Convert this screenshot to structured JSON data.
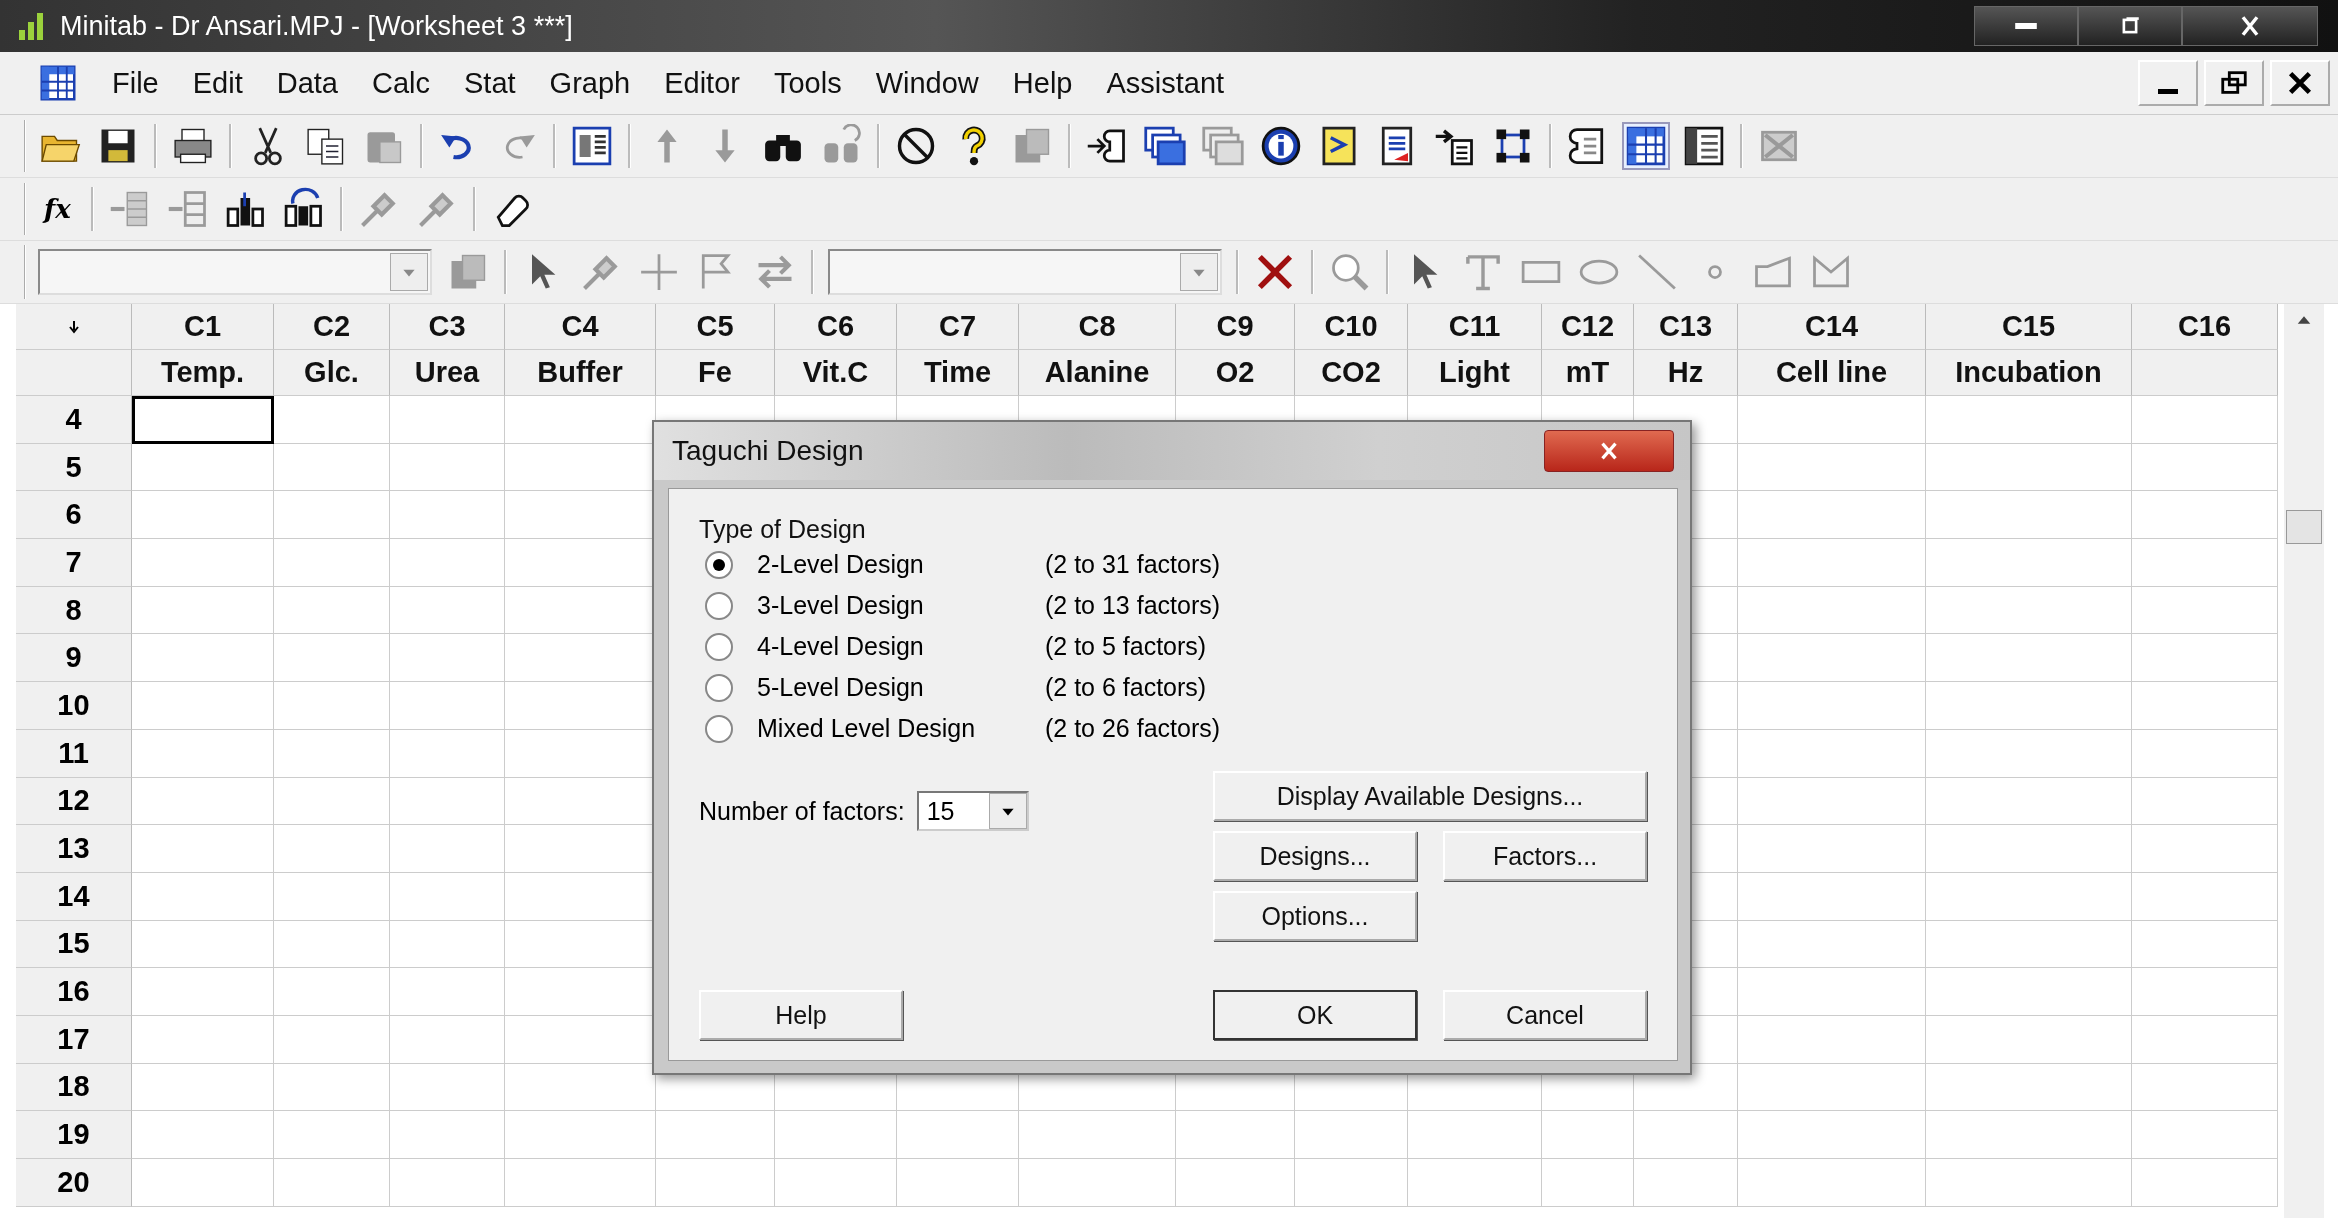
{
  "window": {
    "title": "Minitab - Dr Ansari.MPJ - [Worksheet 3 ***]"
  },
  "menu": [
    "File",
    "Edit",
    "Data",
    "Calc",
    "Stat",
    "Graph",
    "Editor",
    "Tools",
    "Window",
    "Help",
    "Assistant"
  ],
  "formula_toolbar": {
    "label": "fx"
  },
  "worksheet": {
    "columns": [
      {
        "id": "C1",
        "name": "Temp."
      },
      {
        "id": "C2",
        "name": "Glc."
      },
      {
        "id": "C3",
        "name": "Urea"
      },
      {
        "id": "C4",
        "name": "Buffer"
      },
      {
        "id": "C5",
        "name": "Fe"
      },
      {
        "id": "C6",
        "name": "Vit.C"
      },
      {
        "id": "C7",
        "name": "Time"
      },
      {
        "id": "C8",
        "name": "Alanine"
      },
      {
        "id": "C9",
        "name": "O2"
      },
      {
        "id": "C10",
        "name": "CO2"
      },
      {
        "id": "C11",
        "name": "Light"
      },
      {
        "id": "C12",
        "name": "mT"
      },
      {
        "id": "C13",
        "name": "Hz"
      },
      {
        "id": "C14",
        "name": "Cell line"
      },
      {
        "id": "C15",
        "name": "Incubation"
      },
      {
        "id": "C16"
      }
    ],
    "rows": [
      {
        "label": "4",
        "active": true
      },
      {
        "label": "5",
        "active": false
      },
      {
        "label": "6",
        "active": false
      },
      {
        "label": "7",
        "active": false
      },
      {
        "label": "8",
        "active": false
      },
      {
        "label": "9",
        "active": false
      },
      {
        "label": "10",
        "active": false
      },
      {
        "label": "11",
        "active": false
      },
      {
        "label": "12",
        "active": false
      },
      {
        "label": "13",
        "active": false
      },
      {
        "label": "14",
        "active": false
      },
      {
        "label": "15",
        "active": false
      },
      {
        "label": "16",
        "active": false
      },
      {
        "label": "17",
        "active": false
      },
      {
        "label": "18",
        "active": false
      },
      {
        "label": "19",
        "active": false
      },
      {
        "label": "20",
        "active": false
      }
    ]
  },
  "dialog": {
    "title": "Taguchi Design",
    "group_label": "Type of Design",
    "options": [
      {
        "label": "2-Level Design",
        "range": "(2 to 31 factors)",
        "selected": true
      },
      {
        "label": "3-Level Design",
        "range": "(2 to 13 factors)",
        "selected": false
      },
      {
        "label": "4-Level Design",
        "range": "(2 to 5 factors)",
        "selected": false
      },
      {
        "label": "5-Level Design",
        "range": "(2 to 6 factors)",
        "selected": false
      },
      {
        "label": "Mixed Level Design",
        "range": "(2 to 26 factors)",
        "selected": false
      }
    ],
    "factors_label": "Number of factors:",
    "factors_value": "15",
    "buttons": [
      {
        "label": "Display Available Designs...",
        "kind": "wide",
        "default": false
      },
      {
        "label": "Designs...",
        "kind": "half",
        "default": false
      },
      {
        "label": "Factors...",
        "kind": "half",
        "default": false
      },
      {
        "label": "Options...",
        "kind": "half",
        "default": false
      }
    ],
    "footer_buttons": [
      {
        "label": "Help",
        "default": false
      },
      {
        "label": "OK",
        "default": true
      },
      {
        "label": "Cancel",
        "default": false
      }
    ]
  }
}
